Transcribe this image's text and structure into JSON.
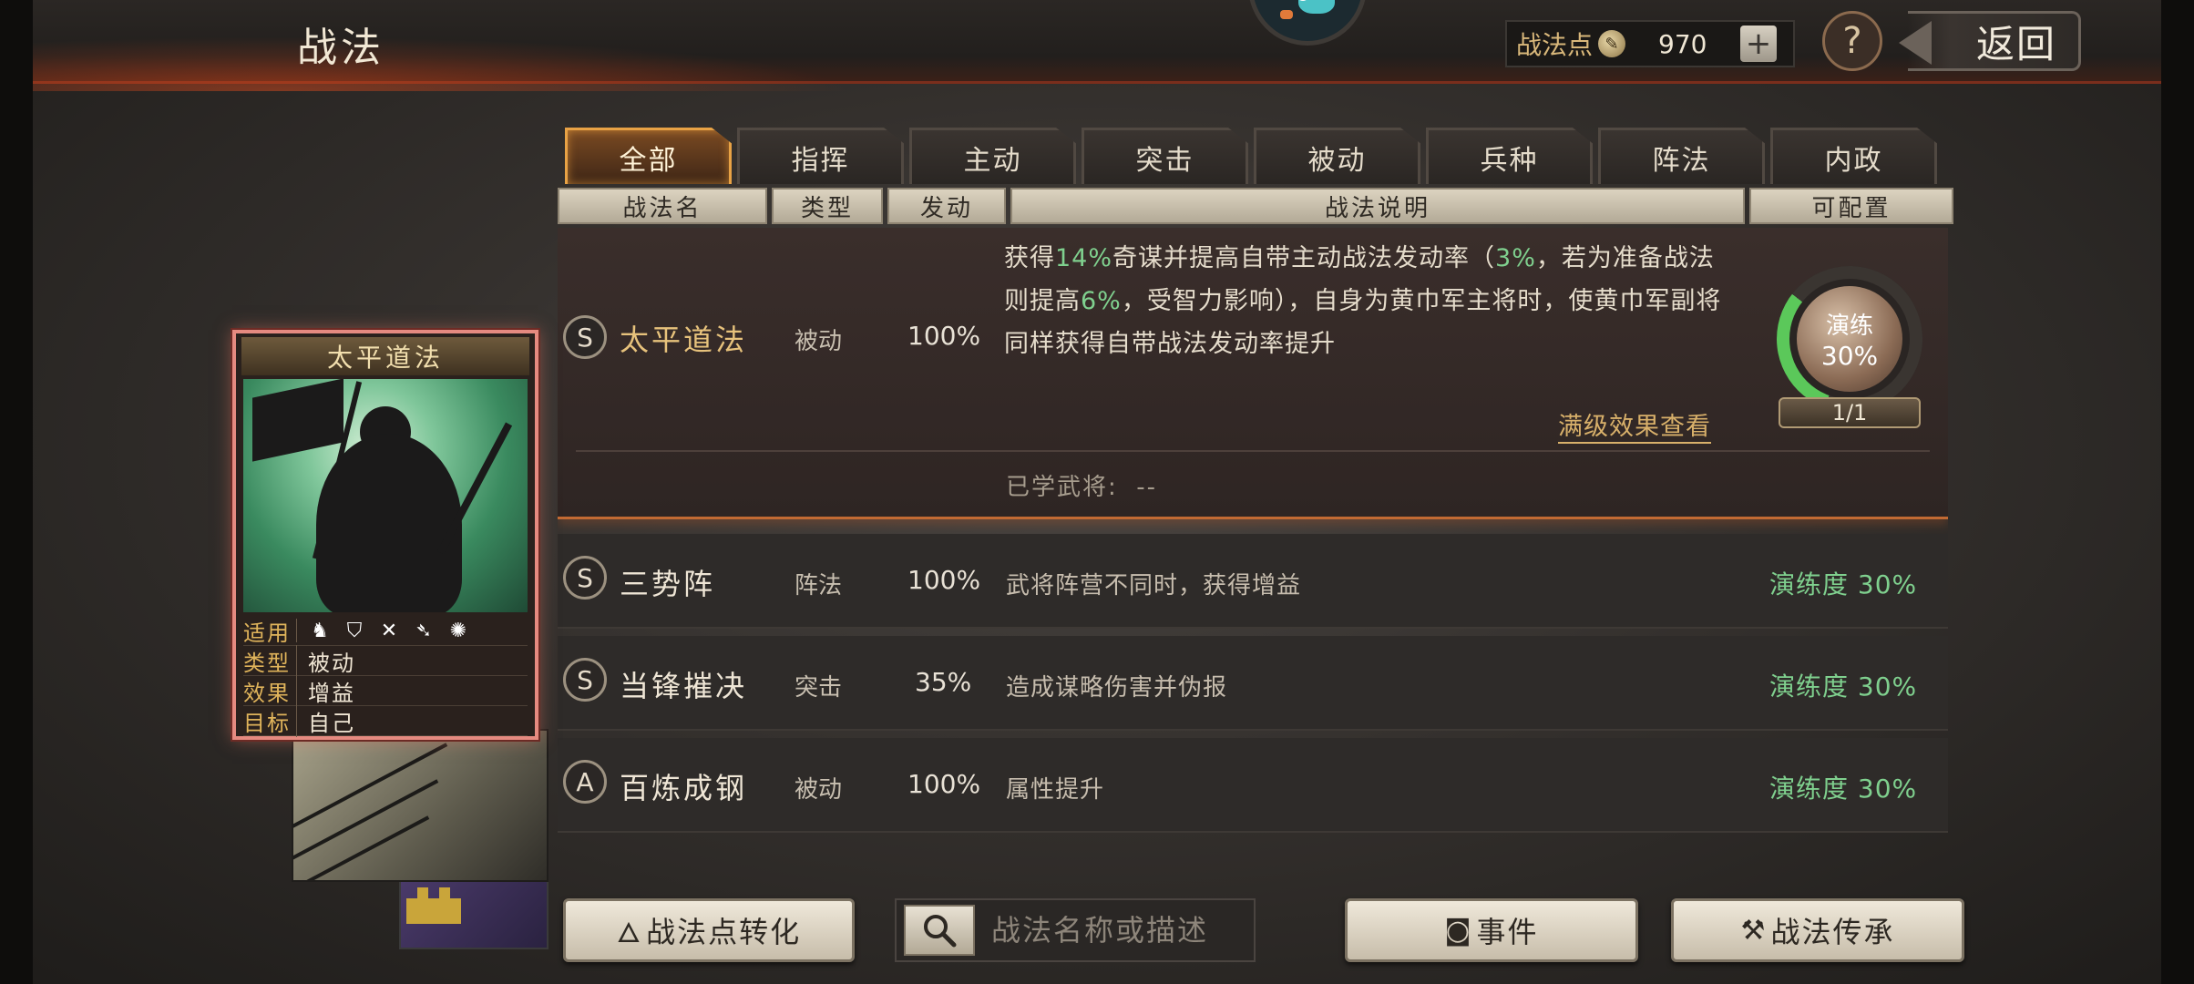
{
  "header": {
    "title": "战法",
    "points_label": "战法点",
    "points_value": "970",
    "back_label": "返回"
  },
  "tabs": [
    {
      "label": "全部",
      "active": true
    },
    {
      "label": "指挥"
    },
    {
      "label": "主动"
    },
    {
      "label": "突击"
    },
    {
      "label": "被动"
    },
    {
      "label": "兵种"
    },
    {
      "label": "阵法"
    },
    {
      "label": "内政"
    }
  ],
  "columns": [
    "战法名",
    "类型",
    "发动",
    "战法说明",
    "可配置"
  ],
  "selected": {
    "grade": "S",
    "name": "太平道法",
    "type": "被动",
    "rate": "100%",
    "desc_parts": [
      "获得",
      "14%",
      "奇谋并提高自带主动战法发动率（",
      "3%",
      "，若为准备战法则提高",
      "6%",
      "，受智力影响），自身为黄巾军主将时，使黄巾军副将同样获得自带战法发动率提升"
    ],
    "full_effect_link": "满级效果查看",
    "learned_label": "已学武将:",
    "learned_value": "--",
    "practice_label": "演练",
    "practice_value": "30%",
    "config_count": "1/1",
    "practice_fraction": 0.3
  },
  "rows": [
    {
      "grade": "S",
      "name": "三势阵",
      "type": "阵法",
      "rate": "100%",
      "desc": "武将阵营不同时，获得增益",
      "practice": "演练度 30%"
    },
    {
      "grade": "S",
      "name": "当锋摧决",
      "type": "突击",
      "rate": "35%",
      "desc": "造成谋略伤害并伪报",
      "practice": "演练度 30%"
    },
    {
      "grade": "A",
      "name": "百炼成钢",
      "type": "被动",
      "rate": "100%",
      "desc": "属性提升",
      "practice": "演练度 30%"
    }
  ],
  "card": {
    "title": "太平道法",
    "apply_label": "适用",
    "type_label": "类型",
    "type_value": "被动",
    "effect_label": "效果",
    "effect_value": "增益",
    "target_label": "目标",
    "target_value": "自己",
    "troop_icons": [
      "cavalry-icon",
      "shield-icon",
      "bow-icon",
      "spear-icon",
      "siege-icon"
    ]
  },
  "bottom": {
    "convert_label": "战法点转化",
    "search_placeholder": "战法名称或描述",
    "event_label": "事件",
    "inherit_label": "战法传承"
  }
}
